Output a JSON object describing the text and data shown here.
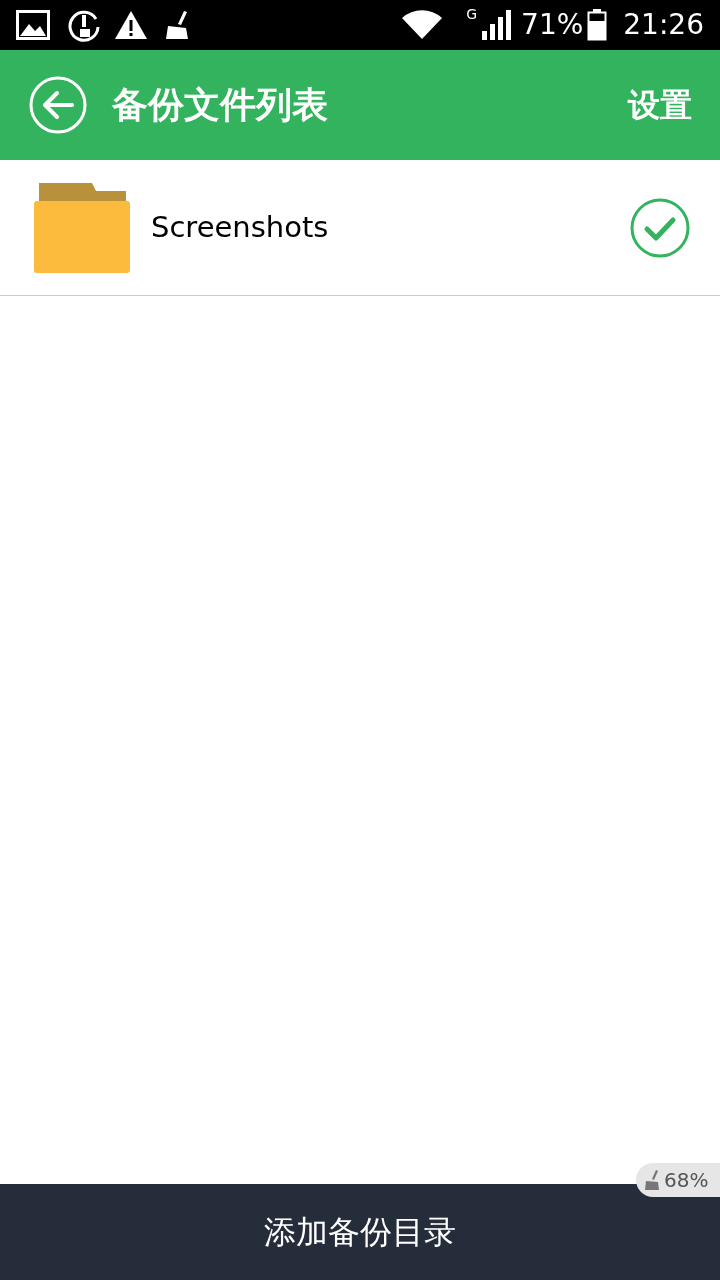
{
  "status_bar": {
    "network": "G",
    "battery": "71%",
    "time": "21:26"
  },
  "header": {
    "title": "备份文件列表",
    "action": "设置"
  },
  "folders": [
    {
      "name": "Screenshots",
      "selected": true
    }
  ],
  "floating_widget": {
    "text": "68%"
  },
  "bottom_button": {
    "label": "添加备份目录"
  }
}
